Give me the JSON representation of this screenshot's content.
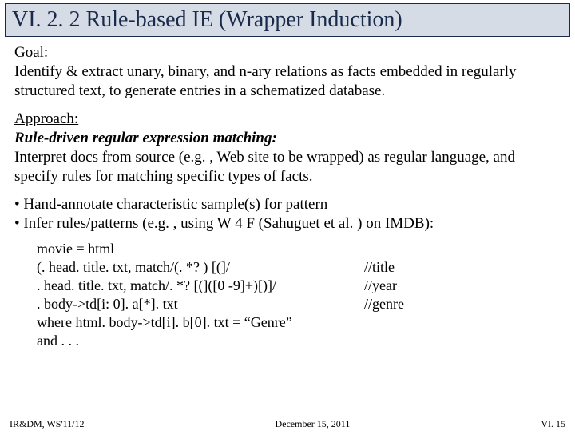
{
  "title": "VI. 2. 2 Rule-based IE (Wrapper Induction)",
  "goal": {
    "label": "Goal:",
    "text": "Identify & extract unary, binary, and n-ary relations as facts embedded in regularly structured text, to generate entries in a schematized database."
  },
  "approach": {
    "label": "Approach:",
    "emph": "Rule-driven regular expression matching:",
    "text": "Interpret docs from source (e.g. , Web site to be wrapped) as regular language, and specify rules for matching specific types of facts."
  },
  "bullets": [
    "• Hand-annotate characteristic sample(s) for pattern",
    "• Infer rules/patterns (e.g. , using W 4 F (Sahuguet et al. ) on IMDB):"
  ],
  "code": {
    "l1": "movie = html",
    "l2": "(. head. title. txt, match/(. *? ) [(]/",
    "c2": "//title",
    "l3": " . head. title. txt, match/. *? [(]([0 -9]+)[)]/",
    "c3": "//year",
    "l4": " . body->td[i: 0]. a[*]. txt",
    "c4": "//genre",
    "l5": "where html. body->td[i]. b[0]. txt = “Genre”",
    "l6": "and . . ."
  },
  "footer": {
    "left": "IR&DM, WS'11/12",
    "center": "December 15, 2011",
    "right": "VI. 15"
  }
}
